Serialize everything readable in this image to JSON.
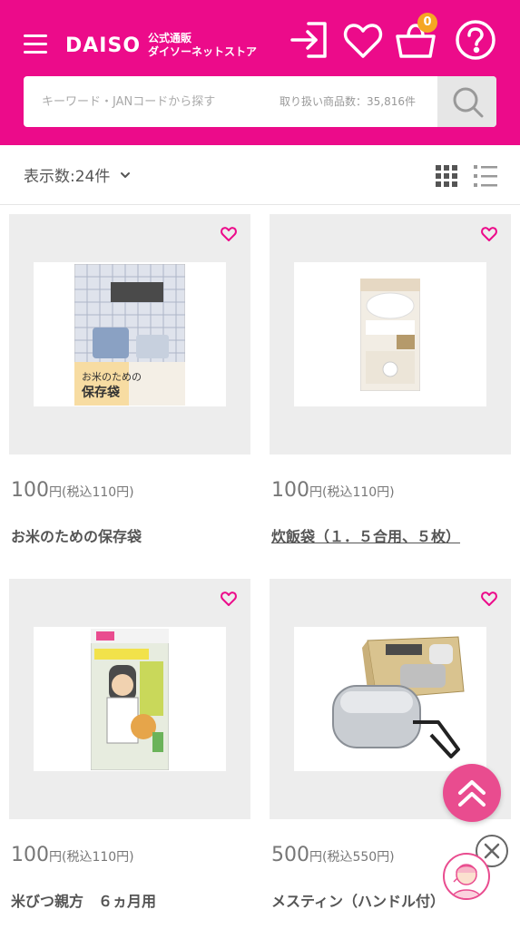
{
  "header": {
    "logo_text": "DAISO",
    "logo_sub1": "公式通販",
    "logo_sub2": "ダイソーネットストア",
    "cart_count": "0",
    "brand_color": "#ec0b8a",
    "icons": [
      "menu-icon",
      "login-icon",
      "heart-icon",
      "cart-icon",
      "help-icon"
    ]
  },
  "search": {
    "placeholder": "キーワード・JANコードから探す",
    "count_text": "取り扱い商品数：35,816件",
    "button_icon": "search-icon"
  },
  "toolbar": {
    "display_count": "表示数:24件",
    "view_icons": [
      "grid-view-icon",
      "list-view-icon"
    ]
  },
  "products": [
    {
      "price": "100",
      "unit": "円",
      "tax": "(税込110円)",
      "name": "お米のための保存袋"
    },
    {
      "price": "100",
      "unit": "円",
      "tax": "(税込110円)",
      "name": "炊飯袋（１．５合用、５枚）"
    },
    {
      "price": "100",
      "unit": "円",
      "tax": "(税込110円)",
      "name": "米びつ親方　６ヵ月用"
    },
    {
      "price": "500",
      "unit": "円",
      "tax": "(税込550円)",
      "name": "メスティン（ハンドル付）"
    }
  ],
  "floating": {
    "scroll_top_icon": "double-chevron-up-icon",
    "close_icon": "close-icon",
    "avatar_icon": "assistant-avatar-icon"
  }
}
